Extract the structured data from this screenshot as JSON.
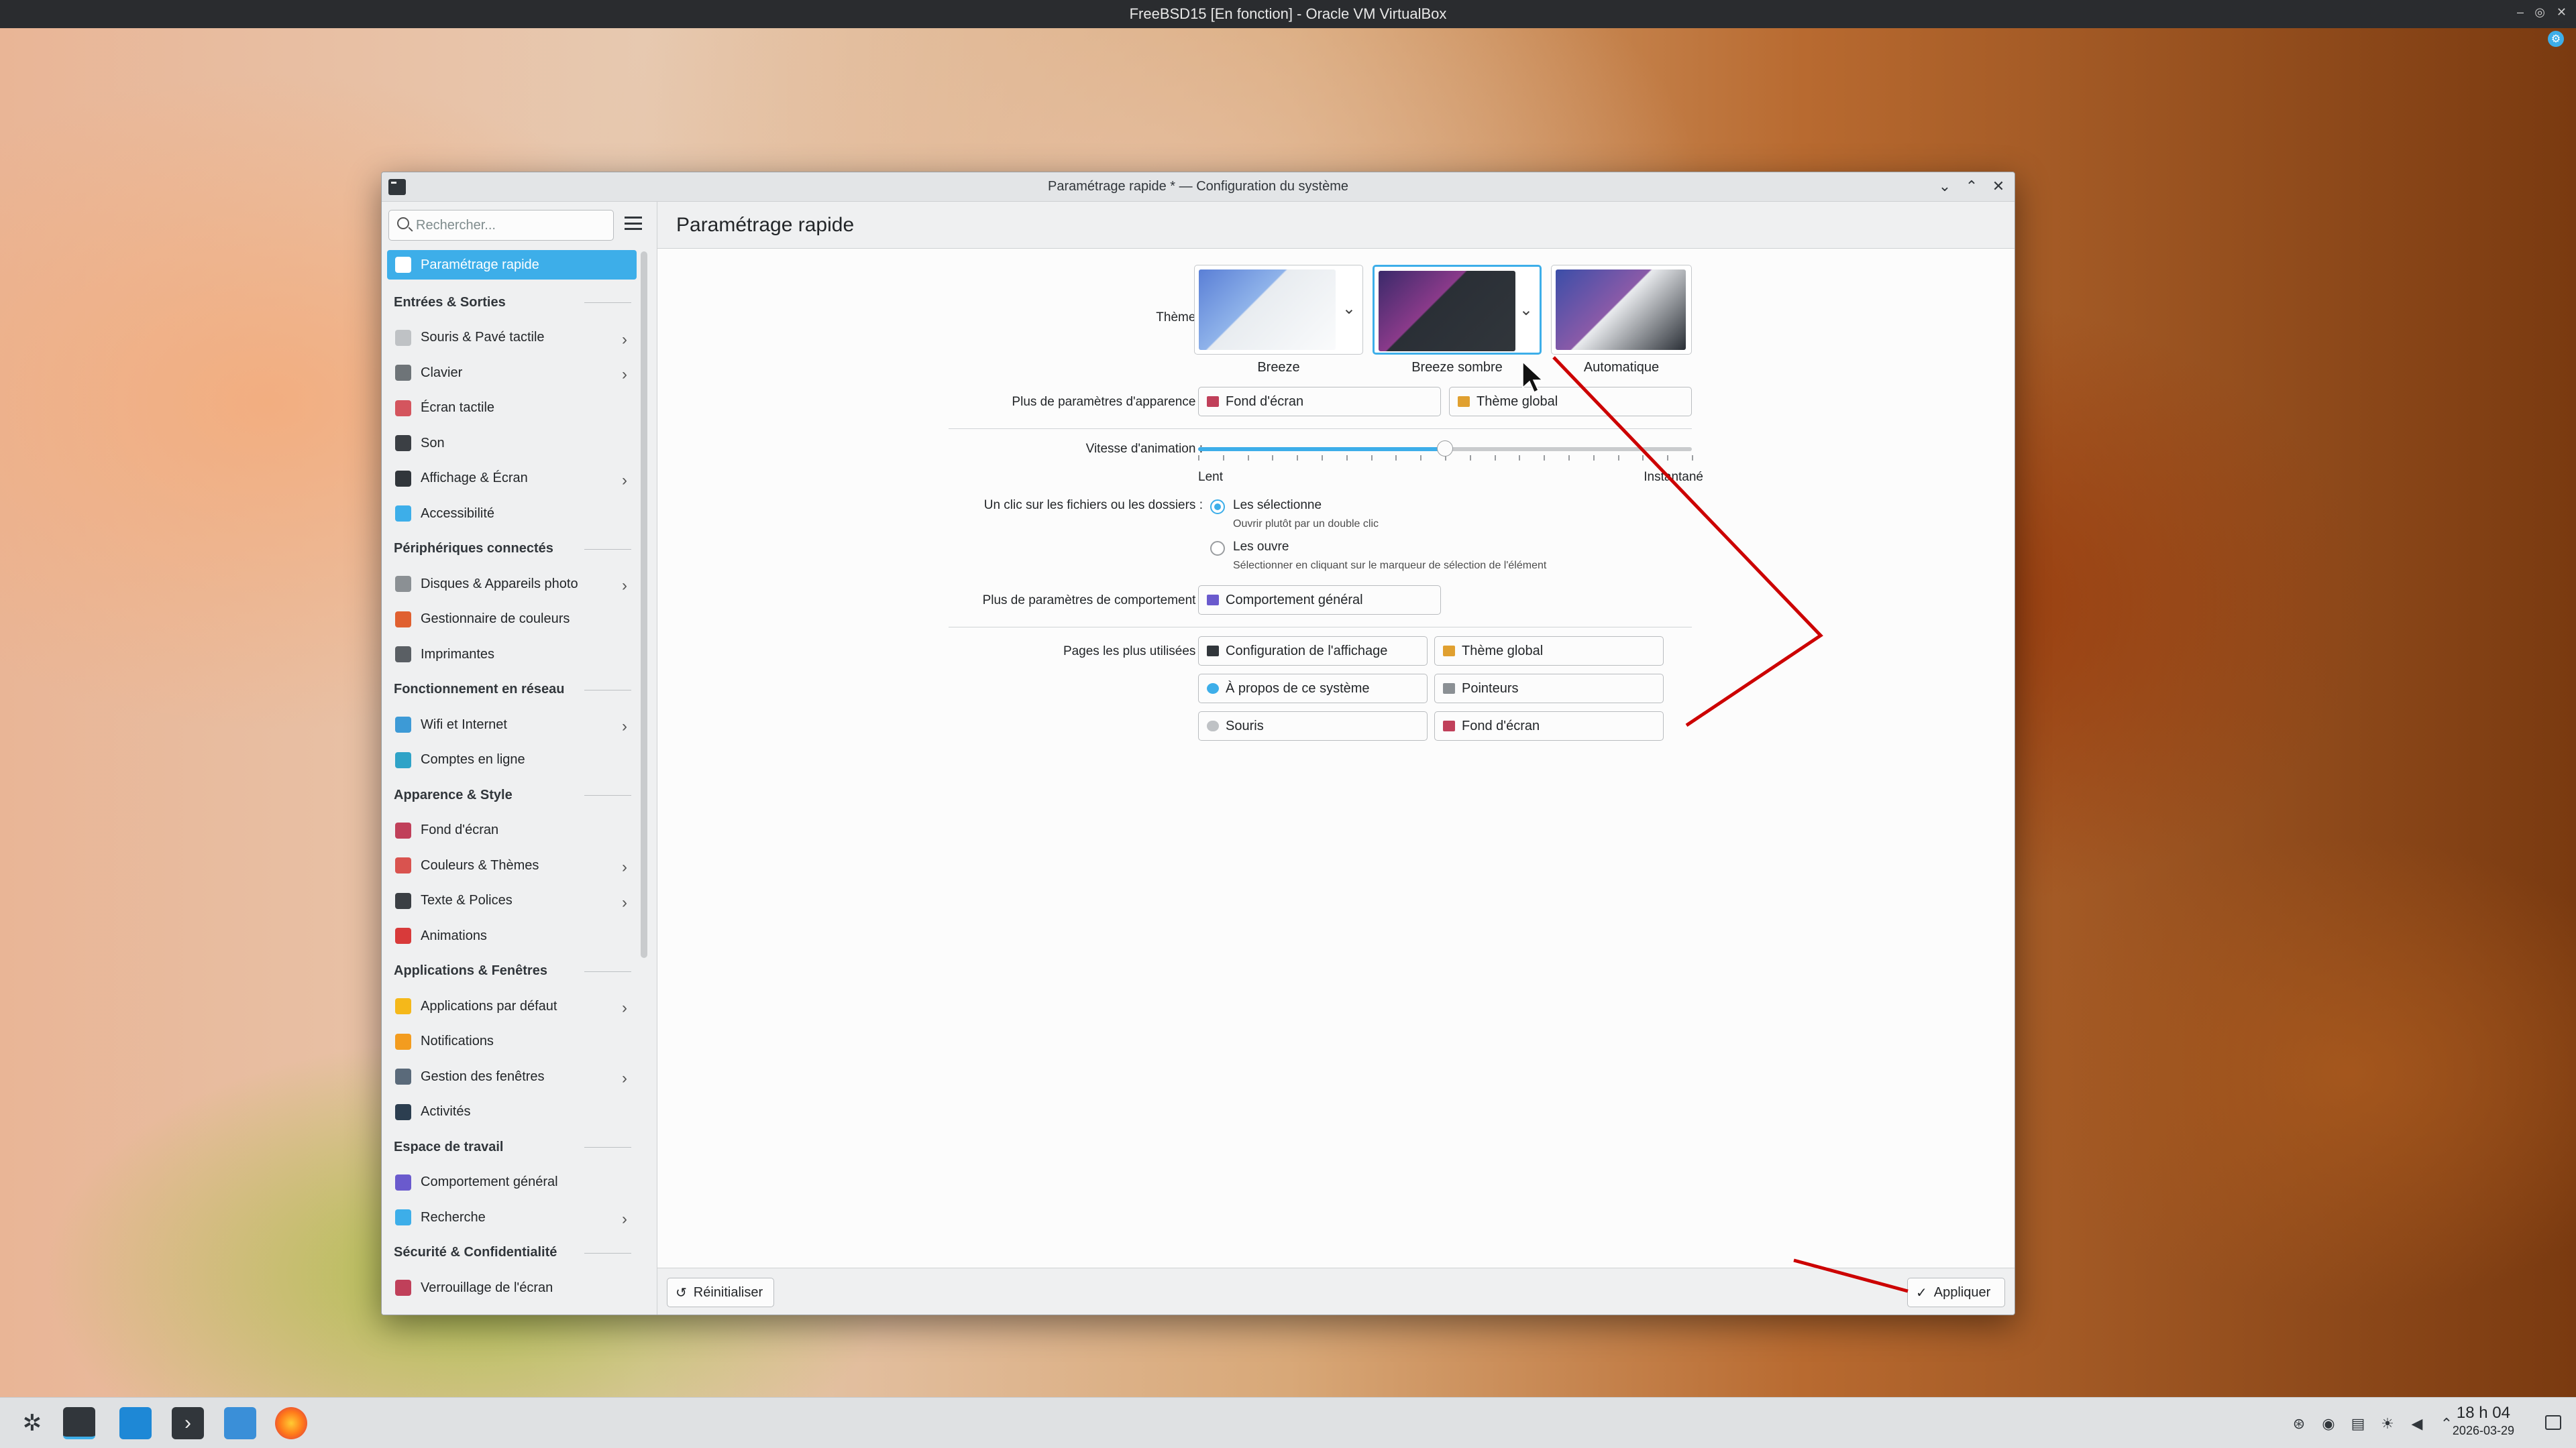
{
  "host": {
    "title": "FreeBSD15 [En fonction] - Oracle VM VirtualBox",
    "controls": [
      "–",
      "◎",
      "✕"
    ]
  },
  "window": {
    "title": "Paramétrage rapide * — Configuration du système",
    "controls": [
      "⌄",
      "⌃",
      "✕"
    ]
  },
  "sidebar": {
    "search_placeholder": "Rechercher...",
    "items": [
      {
        "type": "item",
        "label": "Paramétrage rapide",
        "active": true,
        "color": "#e94f6b"
      },
      {
        "type": "cat",
        "label": "Entrées & Sorties"
      },
      {
        "type": "item",
        "label": "Souris & Pavé tactile",
        "chevron": true,
        "color": "#bfc2c5"
      },
      {
        "type": "item",
        "label": "Clavier",
        "chevron": true,
        "color": "#6e7478"
      },
      {
        "type": "item",
        "label": "Écran tactile",
        "color": "#d4555e"
      },
      {
        "type": "item",
        "label": "Son",
        "color": "#3b3f44"
      },
      {
        "type": "item",
        "label": "Affichage & Écran",
        "chevron": true,
        "color": "#31363b"
      },
      {
        "type": "item",
        "label": "Accessibilité",
        "color": "#3daee9"
      },
      {
        "type": "cat",
        "label": "Périphériques connectés"
      },
      {
        "type": "item",
        "label": "Disques & Appareils photo",
        "chevron": true,
        "color": "#8b9094"
      },
      {
        "type": "item",
        "label": "Gestionnaire de couleurs",
        "color": "#e06030"
      },
      {
        "type": "item",
        "label": "Imprimantes",
        "color": "#5a5f64"
      },
      {
        "type": "cat",
        "label": "Fonctionnement en réseau"
      },
      {
        "type": "item",
        "label": "Wifi et Internet",
        "chevron": true,
        "color": "#3d9ad6"
      },
      {
        "type": "item",
        "label": "Comptes en ligne",
        "color": "#2fa3c7"
      },
      {
        "type": "cat",
        "label": "Apparence & Style"
      },
      {
        "type": "item",
        "label": "Fond d'écran",
        "color": "#c0405a"
      },
      {
        "type": "item",
        "label": "Couleurs & Thèmes",
        "chevron": true,
        "color": "#d9534f"
      },
      {
        "type": "item",
        "label": "Texte & Polices",
        "chevron": true,
        "color": "#3b3f44"
      },
      {
        "type": "item",
        "label": "Animations",
        "color": "#d83a3a"
      },
      {
        "type": "cat",
        "label": "Applications & Fenêtres"
      },
      {
        "type": "item",
        "label": "Applications par défaut",
        "chevron": true,
        "color": "#f5b81a"
      },
      {
        "type": "item",
        "label": "Notifications",
        "color": "#f39c1f"
      },
      {
        "type": "item",
        "label": "Gestion des fenêtres",
        "chevron": true,
        "color": "#5a6a7a"
      },
      {
        "type": "item",
        "label": "Activités",
        "color": "#2c3e50"
      },
      {
        "type": "cat",
        "label": "Espace de travail"
      },
      {
        "type": "item",
        "label": "Comportement général",
        "color": "#6a5acd"
      },
      {
        "type": "item",
        "label": "Recherche",
        "chevron": true,
        "color": "#3daee9"
      },
      {
        "type": "cat",
        "label": "Sécurité & Confidentialité"
      },
      {
        "type": "item",
        "label": "Verrouillage de l'écran",
        "color": "#c0405a"
      }
    ]
  },
  "main": {
    "header": "Paramétrage rapide",
    "theme": {
      "label": "Thème :",
      "options": [
        {
          "name": "Breeze",
          "selected": false,
          "has_dropdown": true
        },
        {
          "name": "Breeze sombre",
          "selected": true,
          "has_dropdown": true
        },
        {
          "name": "Automatique",
          "selected": false,
          "has_dropdown": false
        }
      ]
    },
    "appearance": {
      "label": "Plus de paramètres d'apparence :",
      "buttons": [
        "Fond d'écran",
        "Thème global"
      ]
    },
    "animation": {
      "label": "Vitesse d'animation :",
      "min_label": "Lent",
      "max_label": "Instantané",
      "value": 0.5
    },
    "click": {
      "label": "Un clic sur les fichiers ou les dossiers :",
      "options": [
        {
          "label": "Les sélectionne",
          "hint": "Ouvrir plutôt par un double clic",
          "selected": true
        },
        {
          "label": "Les ouvre",
          "hint": "Sélectionner en cliquant sur le marqueur de sélection de l'élément",
          "selected": false
        }
      ]
    },
    "behavior": {
      "label": "Plus de paramètres de comportement :",
      "button": "Comportement général"
    },
    "most_used": {
      "label": "Pages les plus utilisées :",
      "buttons": [
        "Configuration de l'affichage",
        "Thème global",
        "À propos de ce système",
        "Pointeurs",
        "Souris",
        "Fond d'écran"
      ]
    },
    "footer": {
      "reset": "Réinitialiser",
      "apply": "Appliquer"
    }
  },
  "taskbar": {
    "apps": [
      "application-launcher-icon",
      "system-settings-icon",
      "discover-store-icon",
      "terminal-icon",
      "file-manager-icon",
      "firefox-icon"
    ],
    "time": "18 h 04",
    "date": "2026-03-29"
  },
  "colors": {
    "accent": "#3daee9",
    "annotation": "#cc0000"
  }
}
